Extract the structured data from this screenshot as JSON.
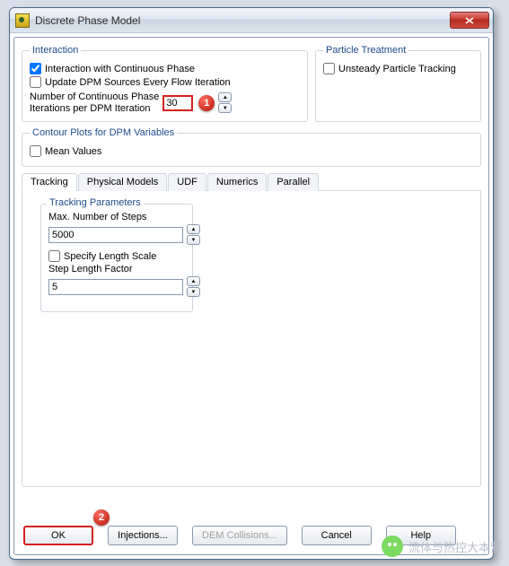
{
  "window": {
    "title": "Discrete Phase Model"
  },
  "interaction": {
    "legend": "Interaction",
    "cb_continuous": {
      "label": "Interaction with Continuous Phase",
      "checked": true
    },
    "cb_update": {
      "label": "Update DPM Sources Every Flow Iteration",
      "checked": false
    },
    "num_iter_label1": "Number of Continuous Phase",
    "num_iter_label2": "Iterations per DPM Iteration",
    "num_iter_value": "30"
  },
  "particle": {
    "legend": "Particle Treatment",
    "cb_unsteady": {
      "label": "Unsteady Particle Tracking",
      "checked": false
    }
  },
  "contour": {
    "legend": "Contour Plots for DPM Variables",
    "cb_mean": {
      "label": "Mean Values",
      "checked": false
    }
  },
  "tabs": [
    "Tracking",
    "Physical Models",
    "UDF",
    "Numerics",
    "Parallel"
  ],
  "tracking": {
    "legend": "Tracking Parameters",
    "max_steps_label": "Max. Number of Steps",
    "max_steps_value": "5000",
    "cb_specify": {
      "label": "Specify Length Scale",
      "checked": false
    },
    "step_len_label": "Step Length Factor",
    "step_len_value": "5"
  },
  "buttons": {
    "ok": "OK",
    "injections": "Injections...",
    "dem": "DEM Collisions...",
    "cancel": "Cancel",
    "help": "Help"
  },
  "callouts": {
    "one": "1",
    "two": "2"
  },
  "watermark": "流体与热控大本营"
}
